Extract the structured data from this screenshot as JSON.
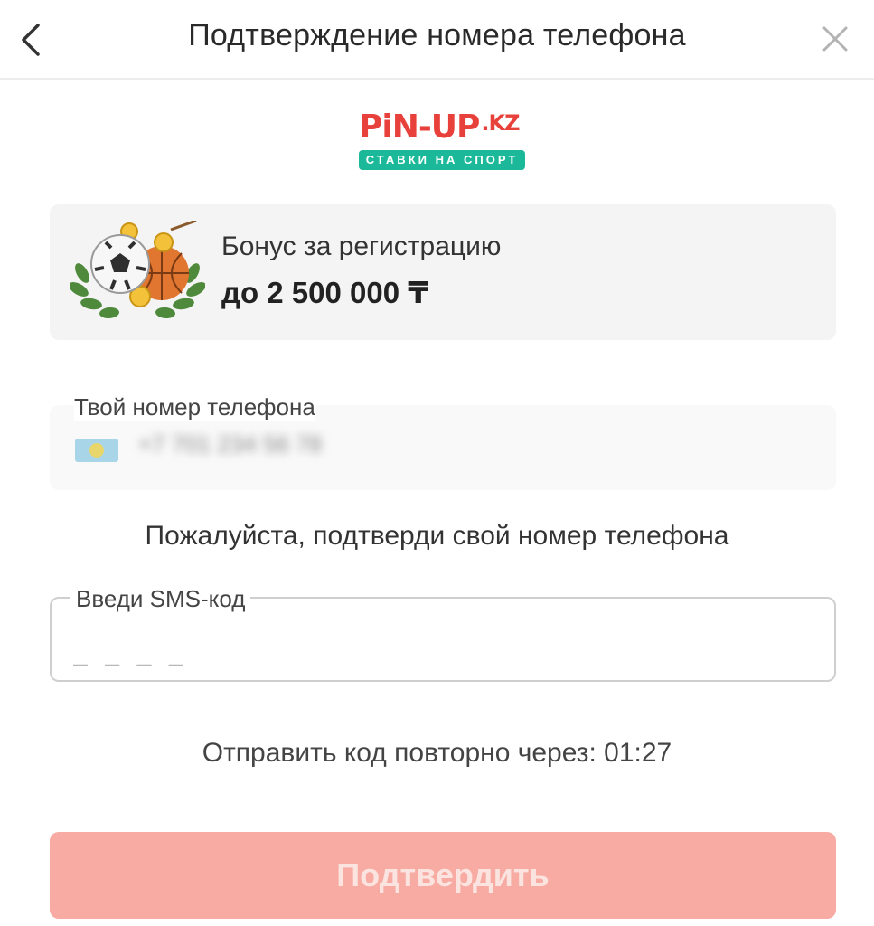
{
  "header": {
    "title": "Подтверждение номера телефона",
    "back_icon": "chevron-left-icon",
    "close_icon": "close-icon"
  },
  "logo": {
    "brand": "PiN-UP",
    "tld": ".KZ",
    "tagline": "СТАВКИ НА СПОРТ"
  },
  "bonus": {
    "line1": "Бонус за регистрацию",
    "line2": "до 2 500 000 ₸",
    "art_icon": "sports-balls-laurel-icon"
  },
  "phone": {
    "label": "Твой номер телефона",
    "flag_icon": "kazakhstan-flag-icon",
    "value": "+7 701 234 56 78"
  },
  "confirm_text": "Пожалуйста, подтверди свой номер телефона",
  "sms": {
    "label": "Введи SMS-код",
    "placeholder": "_ _ _ _",
    "value": ""
  },
  "resend_text": "Отправить код повторно через: 01:27",
  "submit": {
    "label": "Подтвердить"
  },
  "colors": {
    "brand_red": "#e8413b",
    "brand_teal": "#1bb99a",
    "button_disabled": "#f7aba3"
  }
}
